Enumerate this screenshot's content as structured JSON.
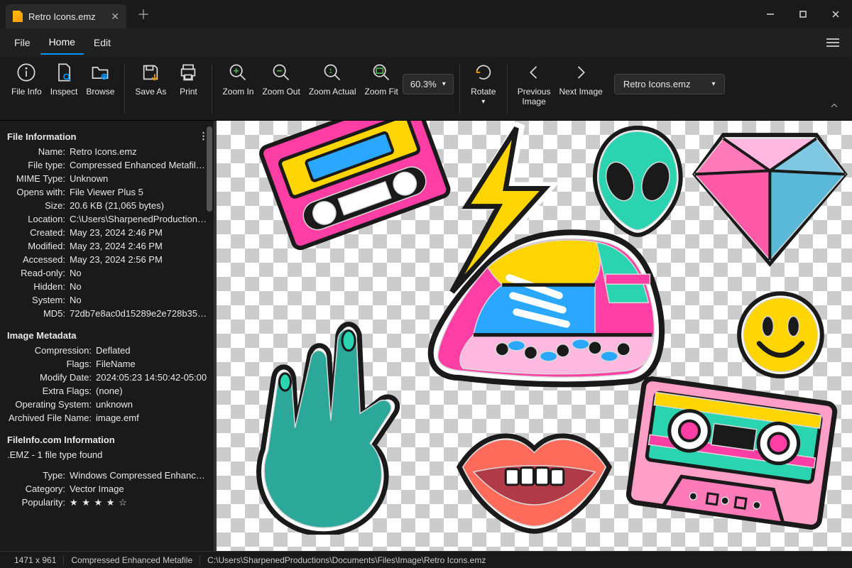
{
  "window": {
    "tab_title": "Retro Icons.emz"
  },
  "menu": {
    "file": "File",
    "home": "Home",
    "edit": "Edit"
  },
  "ribbon": {
    "file_info": "File Info",
    "inspect": "Inspect",
    "browse": "Browse",
    "save_as": "Save As",
    "print": "Print",
    "zoom_in": "Zoom In",
    "zoom_out": "Zoom Out",
    "zoom_actual": "Zoom Actual",
    "zoom_fit": "Zoom Fit",
    "zoom_value": "60.3%",
    "rotate": "Rotate",
    "prev_image": "Previous\nImage",
    "next_image": "Next Image",
    "file_dropdown": "Retro Icons.emz"
  },
  "sidebar": {
    "file_info_head": "File Information",
    "fi": {
      "name_k": "Name:",
      "name_v": "Retro Icons.emz",
      "filetype_k": "File type:",
      "filetype_v": "Compressed Enhanced Metafile (.e...",
      "mime_k": "MIME Type:",
      "mime_v": "Unknown",
      "opens_k": "Opens with:",
      "opens_v": "File Viewer Plus 5",
      "size_k": "Size:",
      "size_v": "20.6 KB (21,065 bytes)",
      "location_k": "Location:",
      "location_v": "C:\\Users\\SharpenedProductions\\D...",
      "created_k": "Created:",
      "created_v": "May 23, 2024 2:46 PM",
      "modified_k": "Modified:",
      "modified_v": "May 23, 2024 2:46 PM",
      "accessed_k": "Accessed:",
      "accessed_v": "May 23, 2024 2:56 PM",
      "readonly_k": "Read-only:",
      "readonly_v": "No",
      "hidden_k": "Hidden:",
      "hidden_v": "No",
      "system_k": "System:",
      "system_v": "No",
      "md5_k": "MD5:",
      "md5_v": "72db7e8ac0d15289e2e728b3593682..."
    },
    "meta_head": "Image Metadata",
    "meta": {
      "compression_k": "Compression:",
      "compression_v": "Deflated",
      "flags_k": "Flags:",
      "flags_v": "FileName",
      "moddate_k": "Modify Date:",
      "moddate_v": "2024:05:23 14:50:42-05:00",
      "extraflags_k": "Extra Flags:",
      "extraflags_v": "(none)",
      "os_k": "Operating System:",
      "os_v": "unknown",
      "archived_k": "Archived File Name:",
      "archived_v": "image.emf"
    },
    "fic_head": "FileInfo.com Information",
    "fic_sub": ".EMZ - 1 file type found",
    "fic": {
      "type_k": "Type:",
      "type_v": "Windows Compressed Enhanced ...",
      "category_k": "Category:",
      "category_v": "Vector Image",
      "popularity_k": "Popularity:",
      "popularity_v": "★ ★ ★ ★ ☆"
    }
  },
  "status": {
    "dims": "1471 x 961",
    "type": "Compressed Enhanced Metafile",
    "path": "C:\\Users\\SharpenedProductions\\Documents\\Files\\Image\\Retro Icons.emz"
  }
}
